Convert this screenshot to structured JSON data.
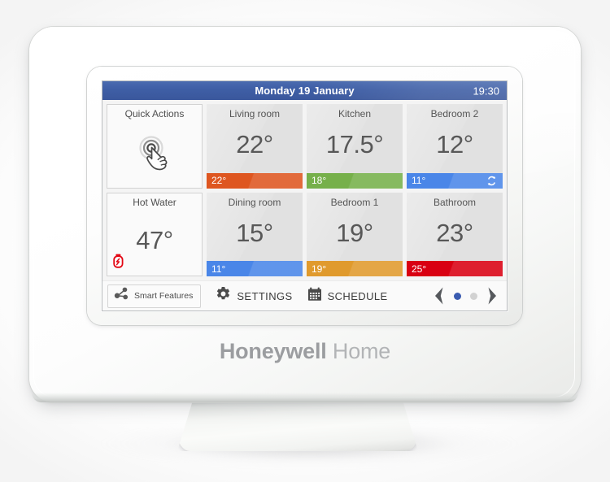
{
  "device": {
    "brand_bold": "Honeywell",
    "brand_light": "Home",
    "product": "wireless-thermostat-controller"
  },
  "screen": {
    "header": {
      "date": "Monday 19 January",
      "time": "19:30",
      "bg_color": "#3f5fa6"
    },
    "tiles": [
      {
        "kind": "action",
        "name": "Quick Actions",
        "icon": "touch-tap-icon",
        "temp": null,
        "footer": null
      },
      {
        "kind": "zone",
        "name": "Living room",
        "temp": "22°",
        "footer": {
          "value": "22°",
          "color": "#de5620",
          "icon": null
        }
      },
      {
        "kind": "zone",
        "name": "Kitchen",
        "temp": "17.5°",
        "footer": {
          "value": "18°",
          "color": "#76b04a",
          "icon": null
        }
      },
      {
        "kind": "zone",
        "name": "Bedroom 2",
        "temp": "12°",
        "footer": {
          "value": "11°",
          "color": "#4a86e8",
          "icon": "cycle-repeat-icon"
        }
      },
      {
        "kind": "action",
        "name": "Hot Water",
        "icon": "hot-water-heating-icon",
        "temp": "47°",
        "footer": null
      },
      {
        "kind": "zone",
        "name": "Dining room",
        "temp": "15°",
        "footer": {
          "value": "11°",
          "color": "#4a86e8",
          "icon": null
        }
      },
      {
        "kind": "zone",
        "name": "Bedroom 1",
        "temp": "19°",
        "footer": {
          "value": "19°",
          "color": "#e09a2d",
          "icon": null
        }
      },
      {
        "kind": "zone",
        "name": "Bathroom",
        "temp": "23°",
        "footer": {
          "value": "25°",
          "color": "#d90012",
          "icon": null
        }
      }
    ],
    "toolbar": {
      "smart_features_label": "Smart Features",
      "smart_features_icon": "network-nodes-icon",
      "settings_label": "SETTINGS",
      "settings_icon": "gear-icon",
      "schedule_label": "SCHEDULE",
      "schedule_icon": "calendar-icon",
      "prev_icon": "chevron-left-icon",
      "next_icon": "chevron-right-icon",
      "page_dots": 2,
      "active_page": 1,
      "active_dot_color": "#3a5bb0"
    }
  }
}
